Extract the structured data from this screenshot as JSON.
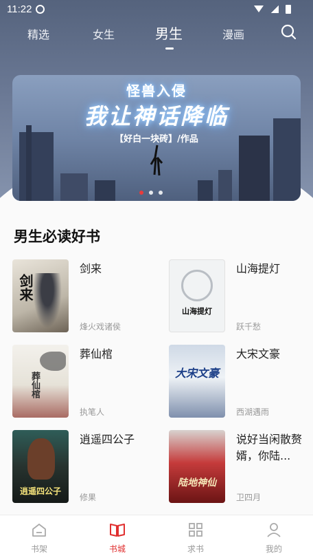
{
  "status_bar": {
    "time": "11:22"
  },
  "top_nav": {
    "tabs": [
      {
        "label": "精选"
      },
      {
        "label": "女生"
      },
      {
        "label": "男生"
      },
      {
        "label": "漫画"
      }
    ],
    "active_tab": "男生"
  },
  "banner": {
    "subtitle": "怪兽入侵",
    "title": "我让神话降临",
    "author_line": "【好白一块砖】/作品",
    "page_count": 3,
    "active_page": 1
  },
  "section": {
    "title": "男生必读好书",
    "books": [
      {
        "title": "剑来",
        "author": "烽火戏诸侯",
        "cover_text": "剑来"
      },
      {
        "title": "山海提灯",
        "author": "跃千愁",
        "cover_text": "山海提灯"
      },
      {
        "title": "葬仙棺",
        "author": "执笔人",
        "cover_text": "葬仙棺"
      },
      {
        "title": "大宋文豪",
        "author": "西湖遇雨",
        "cover_text": "大宋文豪"
      },
      {
        "title": "逍遥四公子",
        "author": "修果",
        "cover_text": "逍遥四公子"
      },
      {
        "title": "说好当闲散赘婿，你陆...",
        "author": "卫四月",
        "cover_text": "陆地神仙"
      }
    ]
  },
  "bottom_nav": {
    "items": [
      {
        "label": "书架",
        "icon": "home-icon"
      },
      {
        "label": "书城",
        "icon": "book-icon"
      },
      {
        "label": "求书",
        "icon": "grid-icon"
      },
      {
        "label": "我的",
        "icon": "user-icon"
      }
    ],
    "active": "书城"
  },
  "colors": {
    "accent": "#e02f2f",
    "header_bg": "#6a7894"
  }
}
